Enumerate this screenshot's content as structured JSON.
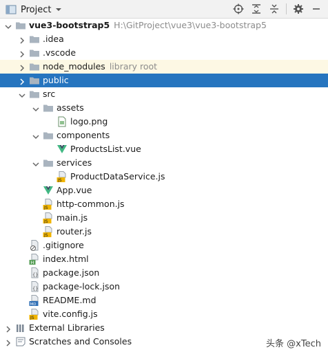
{
  "toolbar": {
    "title": "Project",
    "icons": [
      "crosshair-icon",
      "expand-all-icon",
      "collapse-all-icon",
      "gear-icon",
      "hide-icon"
    ]
  },
  "tree": {
    "rows": [
      {
        "label": "vue3-bootstrap5",
        "hint": "H:\\GitProject\\vue3\\vue3-bootstrap5",
        "icon": "folder",
        "arrow": "down",
        "depth": 0
      },
      {
        "label": ".idea",
        "icon": "folder",
        "arrow": "right",
        "depth": 1
      },
      {
        "label": ".vscode",
        "icon": "folder",
        "arrow": "right",
        "depth": 1
      },
      {
        "label": "node_modules",
        "hint": "library root",
        "icon": "folder",
        "arrow": "right",
        "depth": 1
      },
      {
        "label": "public",
        "icon": "folder",
        "arrow": "right",
        "depth": 1
      },
      {
        "label": "src",
        "icon": "folder",
        "arrow": "down",
        "depth": 1
      },
      {
        "label": "assets",
        "icon": "folder",
        "arrow": "down",
        "depth": 2
      },
      {
        "label": "logo.png",
        "icon": "image",
        "depth": 3
      },
      {
        "label": "components",
        "icon": "folder",
        "arrow": "down",
        "depth": 2
      },
      {
        "label": "ProductsList.vue",
        "icon": "vue",
        "depth": 3
      },
      {
        "label": "services",
        "icon": "folder",
        "arrow": "down",
        "depth": 2
      },
      {
        "label": "ProductDataService.js",
        "icon": "js",
        "depth": 3
      },
      {
        "label": "App.vue",
        "icon": "vue",
        "depth": 2
      },
      {
        "label": "http-common.js",
        "icon": "js",
        "depth": 2
      },
      {
        "label": "main.js",
        "icon": "js",
        "depth": 2
      },
      {
        "label": "router.js",
        "icon": "js",
        "depth": 2
      },
      {
        "label": ".gitignore",
        "icon": "ignore",
        "depth": 1
      },
      {
        "label": "index.html",
        "icon": "html",
        "depth": 1
      },
      {
        "label": "package.json",
        "icon": "json",
        "depth": 1
      },
      {
        "label": "package-lock.json",
        "icon": "json",
        "depth": 1
      },
      {
        "label": "README.md",
        "icon": "md",
        "depth": 1
      },
      {
        "label": "vite.config.js",
        "icon": "js",
        "depth": 1
      },
      {
        "label": "External Libraries",
        "icon": "libraries",
        "arrow": "right",
        "depth": 0
      },
      {
        "label": "Scratches and Consoles",
        "icon": "scratches",
        "arrow": "right",
        "depth": 0
      }
    ],
    "selected_label": "public"
  },
  "watermark": "头条 @xTech",
  "colors": {
    "selection": "#2675bf",
    "library_bg": "#fdf8e4",
    "folder": "#a9b4bf",
    "vue": "#41b883",
    "js_badge": "#f0b400",
    "md_badge": "#2f6fb5"
  }
}
